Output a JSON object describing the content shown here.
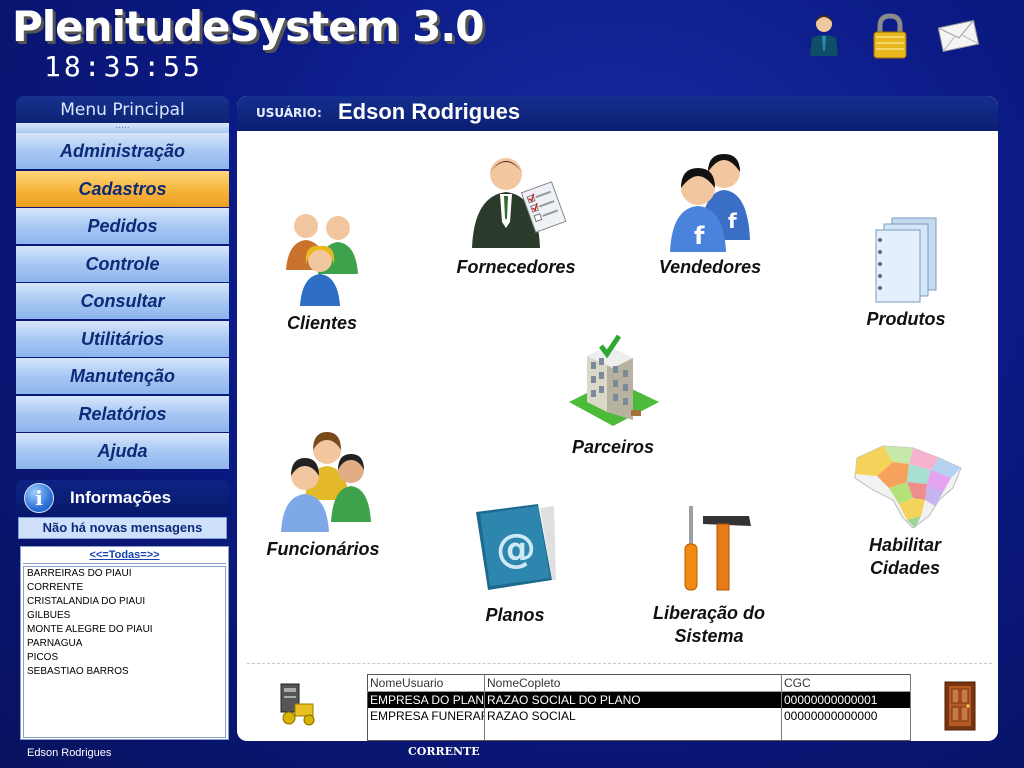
{
  "app": {
    "title": "PlenitudeSystem 3.0",
    "clock": "18:35:55"
  },
  "top_icons": [
    "user-icon",
    "lock-icon",
    "mail-icon"
  ],
  "sidebar": {
    "header": "Menu Principal",
    "grip": ".....",
    "items": [
      {
        "label": "Administração",
        "active": false
      },
      {
        "label": "Cadastros",
        "active": true
      },
      {
        "label": "Pedidos",
        "active": false
      },
      {
        "label": "Controle",
        "active": false
      },
      {
        "label": "Consultar",
        "active": false
      },
      {
        "label": "Utilitários",
        "active": false
      },
      {
        "label": "Manutenção",
        "active": false
      },
      {
        "label": "Relatórios",
        "active": false
      },
      {
        "label": "Ajuda",
        "active": false
      }
    ]
  },
  "info": {
    "title": "Informações",
    "message": "Não há novas mensagens"
  },
  "cities": {
    "all_link": "<<=Todas=>>",
    "items": [
      "BARREIRAS DO PIAUI",
      "CORRENTE",
      "CRISTALANDIA DO PIAUI",
      "GILBUES",
      "MONTE ALEGRE DO PIAUI",
      "PARNAGUA",
      "PICOS",
      "SEBASTIAO BARROS"
    ]
  },
  "footer": {
    "user": "Edson Rodrigues",
    "city": "CORRENTE"
  },
  "main": {
    "user_label": "USUÁRIO:",
    "user_name": "Edson Rodrigues",
    "tiles": {
      "clientes": "Clientes",
      "fornecedores": "Fornecedores",
      "vendedores": "Vendedores",
      "produtos": "Produtos",
      "parceiros": "Parceiros",
      "funcionarios": "Funcionários",
      "planos": "Planos",
      "liberacao_1": "Liberação do",
      "liberacao_2": "Sistema",
      "cidades_1": "Habilitar",
      "cidades_2": "Cidades"
    },
    "grid": {
      "columns": [
        "NomeUsuario",
        "NomeCopleto",
        "CGC"
      ],
      "rows": [
        [
          "EMPRESA DO PLANO",
          "RAZAO SOCIAL DO PLANO",
          "00000000000001"
        ],
        [
          "EMPRESA FUNERARIA",
          "RAZAO SOCIAL",
          "00000000000000"
        ]
      ],
      "selected_row": 0
    }
  }
}
